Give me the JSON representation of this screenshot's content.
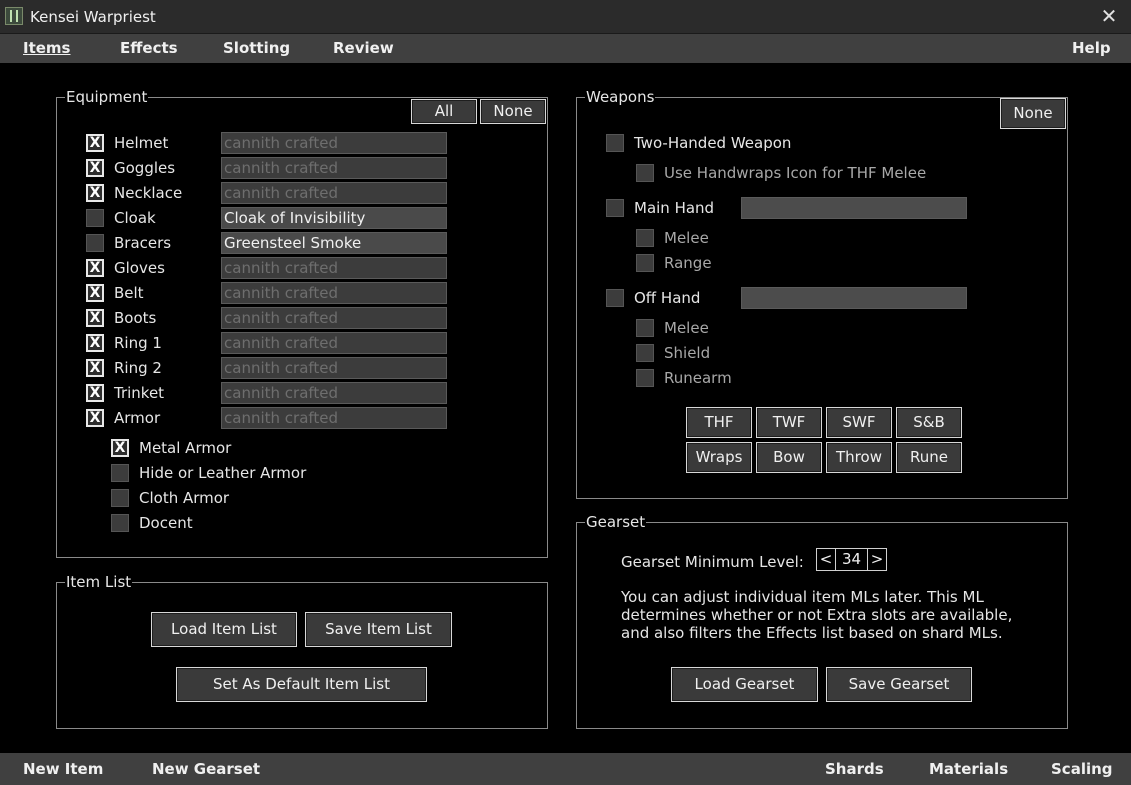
{
  "window": {
    "title": "Kensei Warpriest",
    "close_glyph": "✕"
  },
  "menu": {
    "items": [
      "Items",
      "Effects",
      "Slotting",
      "Review"
    ],
    "help": "Help"
  },
  "footer": {
    "left": [
      "New Item",
      "New Gearset"
    ],
    "right": [
      "Shards",
      "Materials",
      "Scaling"
    ]
  },
  "equipment": {
    "title": "Equipment",
    "all_label": "All",
    "none_label": "None",
    "slots": [
      {
        "label": "Helmet",
        "checked": true,
        "value": "cannith crafted",
        "active": false
      },
      {
        "label": "Goggles",
        "checked": true,
        "value": "cannith crafted",
        "active": false
      },
      {
        "label": "Necklace",
        "checked": true,
        "value": "cannith crafted",
        "active": false
      },
      {
        "label": "Cloak",
        "checked": false,
        "value": "Cloak of Invisibility",
        "active": true
      },
      {
        "label": "Bracers",
        "checked": false,
        "value": "Greensteel Smoke",
        "active": true
      },
      {
        "label": "Gloves",
        "checked": true,
        "value": "cannith crafted",
        "active": false
      },
      {
        "label": "Belt",
        "checked": true,
        "value": "cannith crafted",
        "active": false
      },
      {
        "label": "Boots",
        "checked": true,
        "value": "cannith crafted",
        "active": false
      },
      {
        "label": "Ring 1",
        "checked": true,
        "value": "cannith crafted",
        "active": false
      },
      {
        "label": "Ring 2",
        "checked": true,
        "value": "cannith crafted",
        "active": false
      },
      {
        "label": "Trinket",
        "checked": true,
        "value": "cannith crafted",
        "active": false
      },
      {
        "label": "Armor",
        "checked": true,
        "value": "cannith crafted",
        "active": false
      }
    ],
    "armor_types": [
      {
        "label": "Metal Armor",
        "checked": true
      },
      {
        "label": "Hide or Leather Armor",
        "checked": false
      },
      {
        "label": "Cloth Armor",
        "checked": false
      },
      {
        "label": "Docent",
        "checked": false
      }
    ]
  },
  "item_list": {
    "title": "Item List",
    "load_label": "Load Item List",
    "save_label": "Save Item List",
    "default_label": "Set As Default Item List"
  },
  "weapons": {
    "title": "Weapons",
    "none_label": "None",
    "two_handed": "Two-Handed Weapon",
    "handwraps": "Use Handwraps Icon for THF Melee",
    "main_hand": "Main Hand",
    "main_sub": [
      "Melee",
      "Range"
    ],
    "off_hand": "Off Hand",
    "off_sub": [
      "Melee",
      "Shield",
      "Runearm"
    ],
    "styles_row1": [
      "THF",
      "TWF",
      "SWF",
      "S&B"
    ],
    "styles_row2": [
      "Wraps",
      "Bow",
      "Throw",
      "Rune"
    ]
  },
  "gearset": {
    "title": "Gearset",
    "min_level_label": "Gearset Minimum Level:",
    "dec": "<",
    "level": "34",
    "inc": ">",
    "description": "You can adjust individual item MLs later. This ML determines whether or not Extra slots are available, and also filters the Effects list based on shard MLs.",
    "load_label": "Load Gearset",
    "save_label": "Save Gearset"
  }
}
